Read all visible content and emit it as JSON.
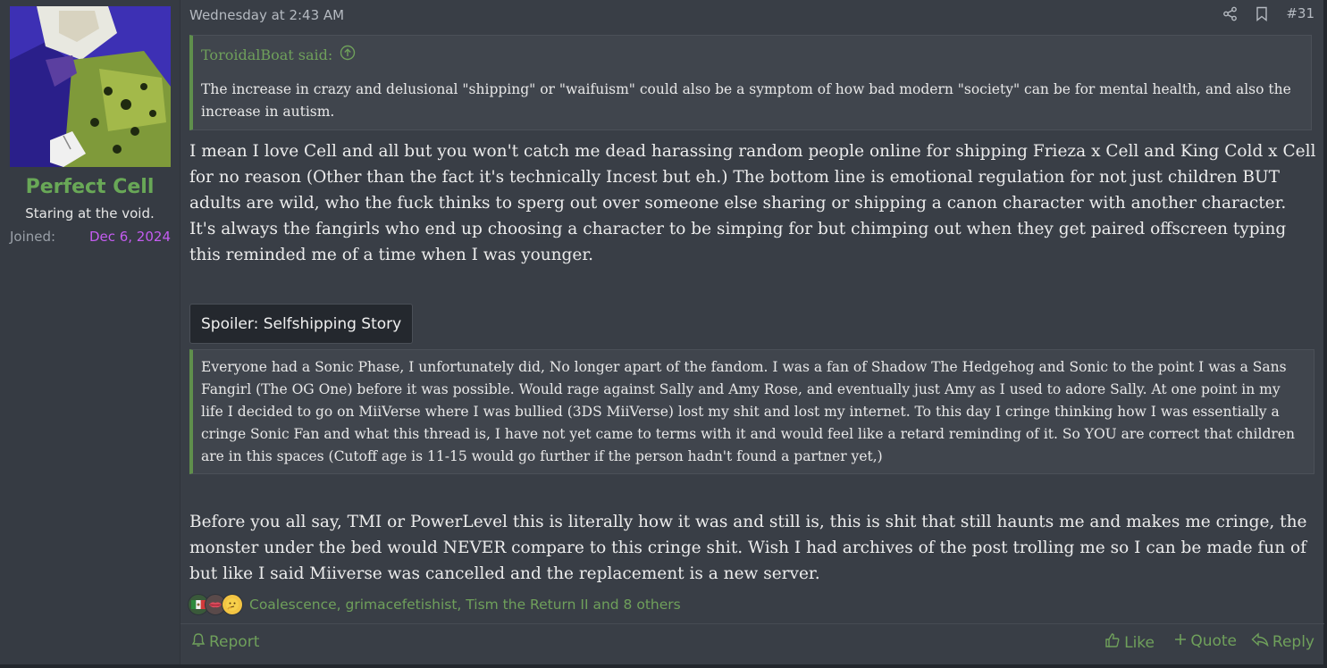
{
  "user": {
    "name": "Perfect Cell",
    "title": "Staring at the void.",
    "joined_label": "Joined:",
    "joined_date": "Dec 6, 2024"
  },
  "post": {
    "date": "Wednesday at 2:43 AM",
    "number": "#31",
    "quote": {
      "author": "ToroidalBoat said:",
      "text": "The increase in crazy and delusional \"shipping\" or \"waifuism\" could also be a symptom of how bad modern \"society\" can be for mental health, and also the increase in autism."
    },
    "paragraph1": "I mean I love Cell and all but you won't catch me dead harassing random people online for shipping Frieza x Cell and King Cold x Cell for no reason (Other than the fact it's technically Incest but eh.) The bottom line is emotional regulation for not just children BUT adults are wild, who the fuck thinks to sperg out over someone else sharing or shipping a canon character with another character. It's always the fangirls who end up choosing a character to be simping for but chimping out when they get paired offscreen typing this reminded me of a time when I was younger.",
    "spoiler": {
      "label": "Spoiler: Selfshipping Story",
      "text": "Everyone had a Sonic Phase, I unfortunately did, No longer apart of the fandom. I was a fan of Shadow The Hedgehog and Sonic to the point I was a Sans Fangirl (The OG One) before it was possible. Would rage against Sally and Amy Rose, and eventually just Amy as I used to adore Sally. At one point in my life I decided to go on MiiVerse where I was bullied (3DS MiiVerse) lost my shit and lost my internet. To this day I cringe thinking how I was essentially a cringe Sonic Fan and what this thread is, I have not yet came to terms with it and would feel like a retard reminding of it. So YOU are correct that children are in this spaces (Cutoff age is 11-15 would go further if the person hadn't found a partner yet,)"
    },
    "paragraph2": "Before you all say, TMI or PowerLevel this is literally how it was and still is, this is shit that still haunts me and makes me cringe, the monster under the bed would NEVER compare to this cringe shit. Wish I had archives of the post trolling me so I can be made fun of but like I said Miiverse was cancelled and the replacement is a new server.",
    "reactions": {
      "icons": [
        "mexico-flag-icon",
        "lips-icon",
        "thinking-face-icon"
      ],
      "names": "Coalescence, grimacefetishist, Tism the Return II and 8 others"
    }
  },
  "actions": {
    "report": "Report",
    "like": "Like",
    "quote": "Quote",
    "reply": "Reply"
  }
}
